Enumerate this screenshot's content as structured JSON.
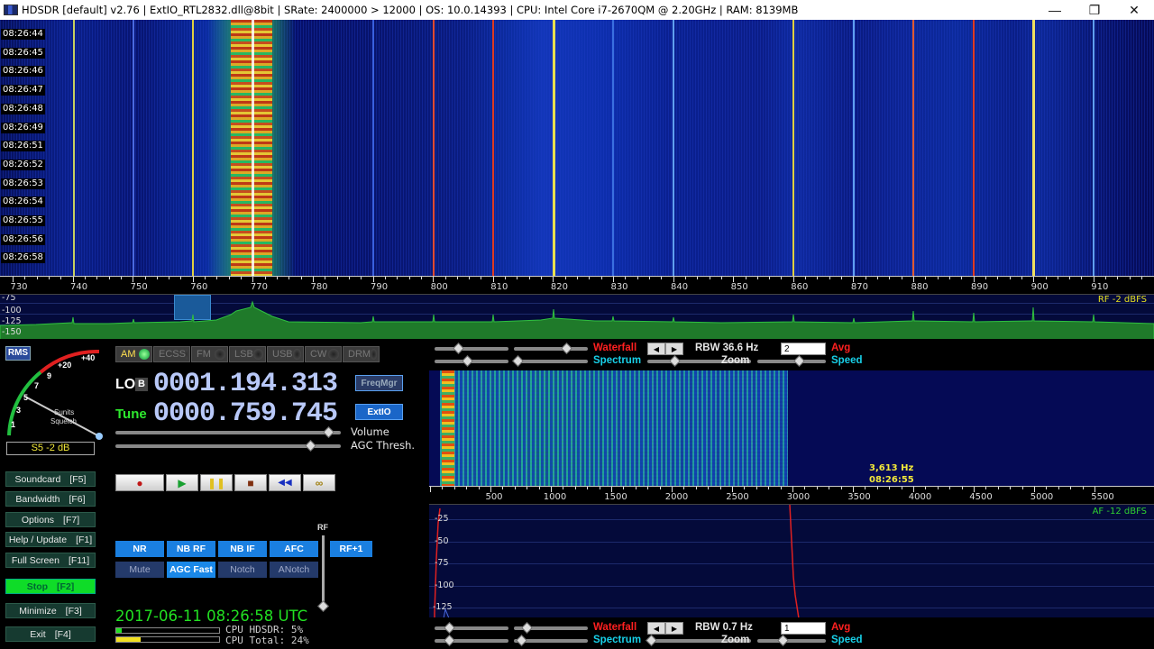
{
  "window": {
    "title": "HDSDR  [default]  v2.76   |  ExtIO_RTL2832.dll@8bit  |  SRate: 2400000 > 12000  |  OS: 10.0.14393   |  CPU: Intel Core i7-2670QM @ 2.20GHz  |  RAM: 8139MB",
    "minimize": "—",
    "restore": "❐",
    "close": "✕"
  },
  "main_waterfall": {
    "time_labels": [
      "08:26:44",
      "08:26:45",
      "08:26:46",
      "08:26:47",
      "08:26:48",
      "08:26:49",
      "08:26:51",
      "08:26:52",
      "08:26:53",
      "08:26:54",
      "08:26:55",
      "08:26:56",
      "08:26:58"
    ],
    "freq_labels": [
      "730",
      "740",
      "750",
      "760",
      "770",
      "780",
      "790",
      "800",
      "810",
      "820",
      "830",
      "840",
      "850",
      "860",
      "870",
      "880",
      "890",
      "900",
      "910"
    ],
    "db_labels": [
      "-75",
      "-100",
      "-125",
      "-150"
    ],
    "rf_level": "RF  -2 dBFS"
  },
  "smeter": {
    "rms_label": "RMS",
    "scale_labels": [
      "+40",
      "+20",
      "9",
      "7",
      "5",
      "3",
      "1"
    ],
    "caption1": "Sunits",
    "caption2": "Squelch",
    "readout": "S5 -2 dB"
  },
  "modes": [
    {
      "label": "AM",
      "active": true
    },
    {
      "label": "ECSS",
      "active": false
    },
    {
      "label": "FM",
      "active": false
    },
    {
      "label": "LSB",
      "active": false
    },
    {
      "label": "USB",
      "active": false
    },
    {
      "label": "CW",
      "active": false
    },
    {
      "label": "DRM",
      "active": false
    }
  ],
  "frequency": {
    "lo_label": "LO",
    "lo_b": "B",
    "lo_value": "0001.194.313",
    "tune_label": "Tune",
    "tune_value": "0000.759.745",
    "freqmgr": "FreqMgr",
    "extio": "ExtIO"
  },
  "sliders": {
    "volume": "Volume",
    "agc": "AGC Thresh."
  },
  "transport": {
    "record": "●",
    "play": "▶",
    "pause": "❚❚",
    "stop": "■",
    "rewind": "◀◀",
    "loop": "∞"
  },
  "dsp": {
    "nr": "NR",
    "nb_rf": "NB RF",
    "nb_if": "NB IF",
    "afc": "AFC",
    "rf_plus": "RF+1",
    "mute": "Mute",
    "agc_fast": "AGC Fast",
    "notch": "Notch",
    "anotch": "ANotch",
    "rf_label": "RF"
  },
  "side_buttons": [
    {
      "label": "Soundcard",
      "key": "[F5]"
    },
    {
      "label": "Bandwidth",
      "key": "[F6]"
    },
    {
      "label": "Options",
      "key": "[F7]"
    },
    {
      "label": "Help / Update",
      "key": "[F1]"
    },
    {
      "label": "Full Screen",
      "key": "[F11]"
    },
    {
      "label": "Stop",
      "key": "[F2]"
    },
    {
      "label": "Minimize",
      "key": "[F3]"
    },
    {
      "label": "Exit",
      "key": "[F4]"
    }
  ],
  "status": {
    "datetime": "2017-06-11   08:26:58 UTC",
    "cpu_hdsdr": "CPU HDSDR:  5%",
    "cpu_total": "CPU Total:  24%",
    "cpu_hdsdr_pct": 5,
    "cpu_total_pct": 24
  },
  "top_controls": {
    "waterfall": "Waterfall",
    "spectrum": "Spectrum",
    "rbw": "RBW  36.6 Hz",
    "zoom": "Zoom",
    "avg_value": "2",
    "avg": "Avg",
    "speed": "Speed"
  },
  "bottom_controls": {
    "waterfall": "Waterfall",
    "spectrum": "Spectrum",
    "rbw": "RBW   0.7 Hz",
    "zoom": "Zoom",
    "avg_value": "1",
    "avg": "Avg",
    "speed": "Speed"
  },
  "audio": {
    "cursor_freq": "3,613 Hz",
    "cursor_time": "08:26:55",
    "freq_labels": [
      "500",
      "1000",
      "1500",
      "2000",
      "2500",
      "3000",
      "3500",
      "4000",
      "4500",
      "5000",
      "5500"
    ],
    "db_labels": [
      "-25",
      "-50",
      "-75",
      "-100",
      "-125"
    ],
    "af_level": "AF  -12 dBFS"
  },
  "colors": {
    "waterfall_bg": "#050a55",
    "spectrum_green": "#1f8a2a",
    "label_red": "#ff2020",
    "label_cyan": "#18d0e8",
    "label_yellow": "#f2e83a"
  }
}
